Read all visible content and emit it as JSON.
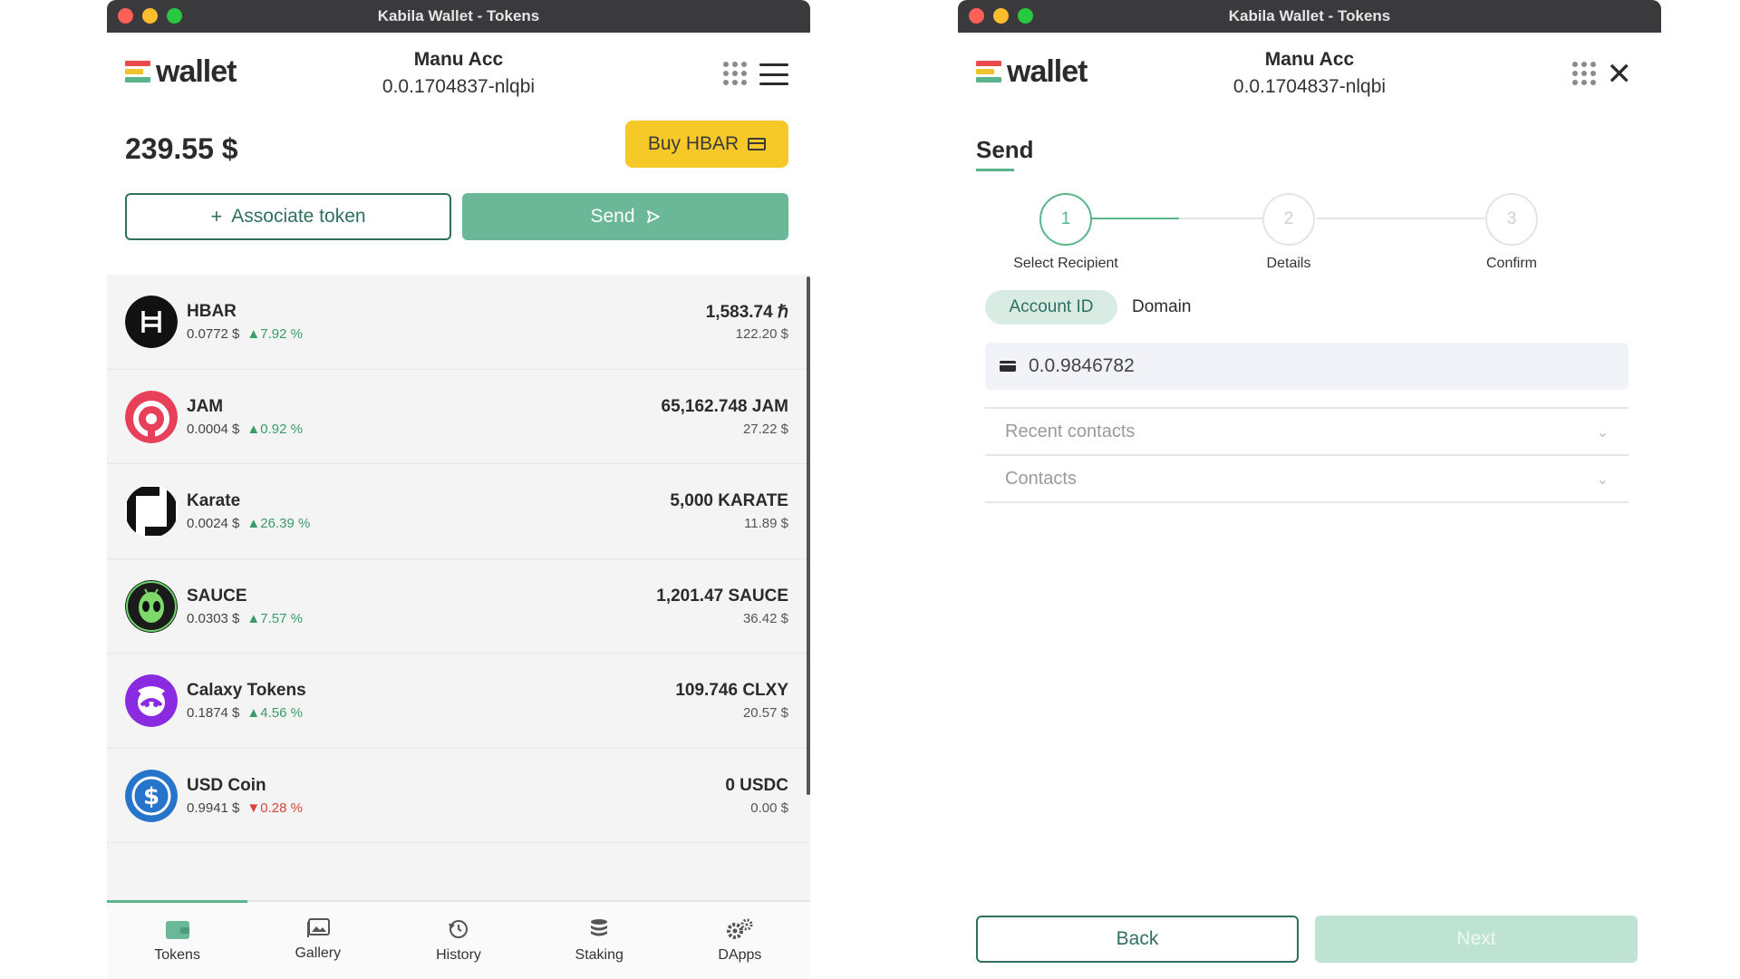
{
  "window_title": "Kabila Wallet - Tokens",
  "brand": {
    "logo_text": "wallet"
  },
  "account": {
    "name": "Manu Acc",
    "id": "0.0.1704837-nlqbi"
  },
  "left": {
    "balance": "239.55 $",
    "buy_label": "Buy HBAR",
    "associate_label": "Associate token",
    "send_label": "Send",
    "tokens": [
      {
        "name": "HBAR",
        "price": "0.0772 $",
        "change": "7.92 %",
        "direction": "up",
        "amount": "1,583.74 ℏ",
        "usd": "122.20 $",
        "icon": "hbar-icon"
      },
      {
        "name": "JAM",
        "price": "0.0004 $",
        "change": "0.92 %",
        "direction": "up",
        "amount": "65,162.748 JAM",
        "usd": "27.22 $",
        "icon": "jam-icon"
      },
      {
        "name": "Karate",
        "price": "0.0024 $",
        "change": "26.39 %",
        "direction": "up",
        "amount": "5,000 KARATE",
        "usd": "11.89 $",
        "icon": "karate-icon"
      },
      {
        "name": "SAUCE",
        "price": "0.0303 $",
        "change": "7.57 %",
        "direction": "up",
        "amount": "1,201.47 SAUCE",
        "usd": "36.42 $",
        "icon": "sauce-icon"
      },
      {
        "name": "Calaxy Tokens",
        "price": "0.1874 $",
        "change": "4.56 %",
        "direction": "up",
        "amount": "109.746 CLXY",
        "usd": "20.57 $",
        "icon": "calaxy-icon"
      },
      {
        "name": "USD Coin",
        "price": "0.9941 $",
        "change": "0.28 %",
        "direction": "down",
        "amount": "0 USDC",
        "usd": "0.00 $",
        "icon": "usdc-icon"
      }
    ],
    "nav": [
      {
        "label": "Tokens",
        "icon": "wallet-icon",
        "active": true
      },
      {
        "label": "Gallery",
        "icon": "gallery-icon"
      },
      {
        "label": "History",
        "icon": "history-icon"
      },
      {
        "label": "Staking",
        "icon": "staking-icon"
      },
      {
        "label": "DApps",
        "icon": "dapps-icon"
      }
    ]
  },
  "right": {
    "title": "Send",
    "steps": [
      {
        "num": "1",
        "label": "Select Recipient",
        "active": true
      },
      {
        "num": "2",
        "label": "Details"
      },
      {
        "num": "3",
        "label": "Confirm"
      }
    ],
    "tabs": {
      "account_id": "Account ID",
      "domain": "Domain"
    },
    "recipient_value": "0.0.9846782",
    "recent_contacts": "Recent contacts",
    "contacts": "Contacts",
    "back_label": "Back",
    "next_label": "Next"
  },
  "colors": {
    "accent": "#5bb58a",
    "buy": "#f6c928",
    "up": "#3a9b6a",
    "down": "#d9443b"
  }
}
